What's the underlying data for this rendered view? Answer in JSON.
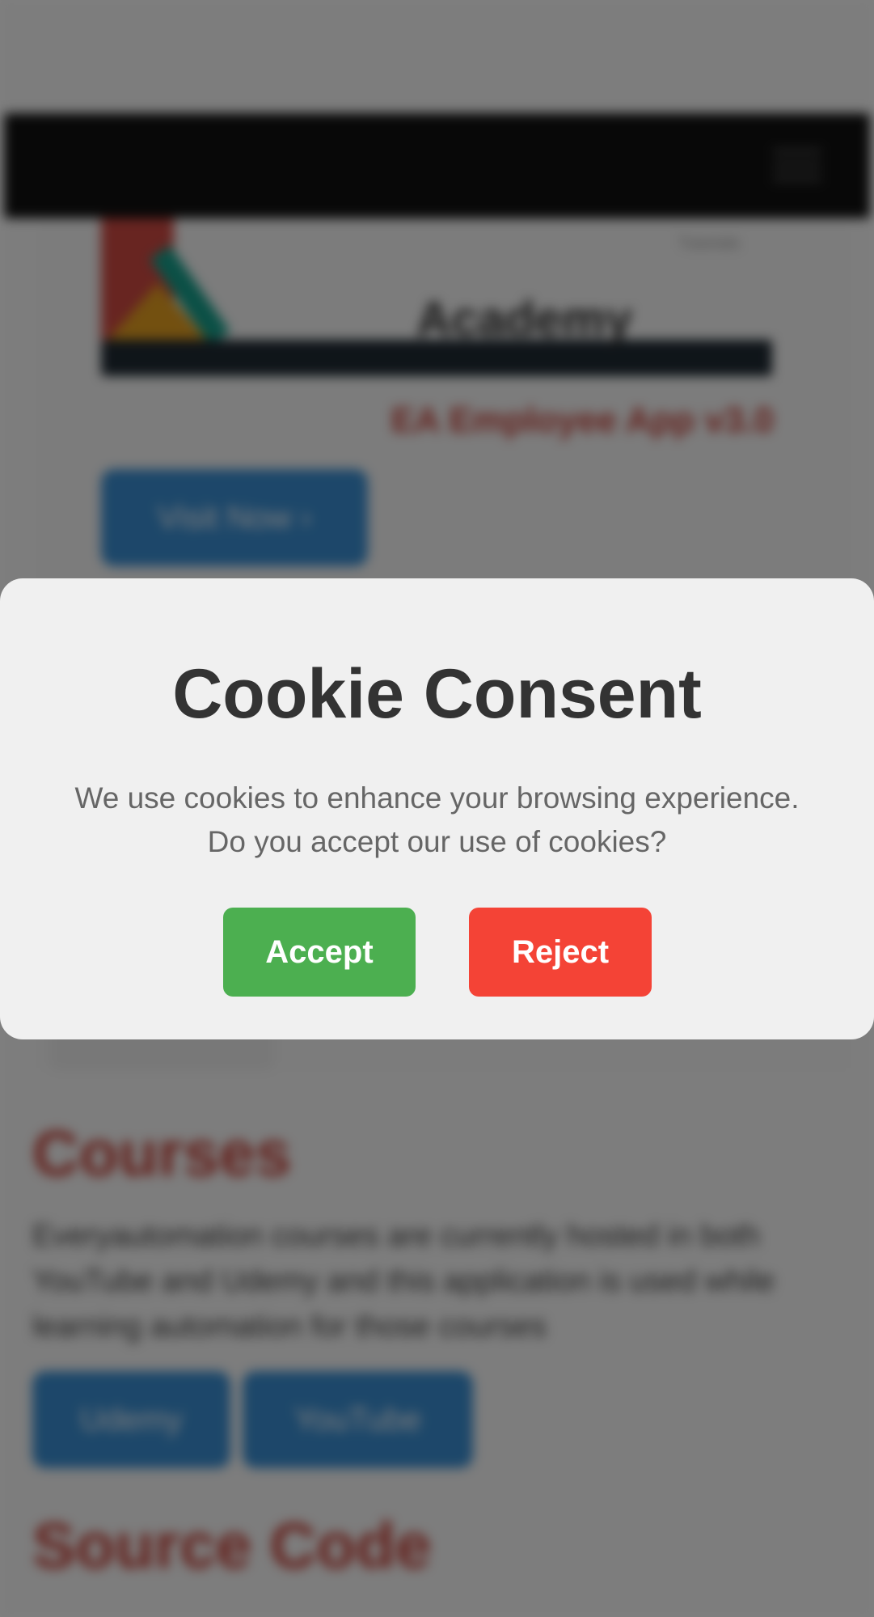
{
  "background": {
    "app_version": "EA Employee App v3.0",
    "visit_button_label": "Visit Now ›",
    "logo_text": "Academy",
    "logo_sub": "Tutorials",
    "courses": {
      "title": "Courses",
      "description": "Everyautomation courses are currently hosted in both YouTube and Udemy and this application is used while learning automation for those courses",
      "buttons": [
        "Udemy",
        "YouTube"
      ]
    },
    "source_code_title": "Source Code"
  },
  "cookie_modal": {
    "title": "Cookie Consent",
    "message_line1": "We use cookies to enhance your browsing experience.",
    "message_line2": "Do you accept our use of cookies?",
    "accept_label": "Accept",
    "reject_label": "Reject"
  },
  "colors": {
    "accept": "#4caf50",
    "reject": "#f44336",
    "modal_background": "#f0f0f0",
    "title": "#333333",
    "message": "#666666"
  }
}
